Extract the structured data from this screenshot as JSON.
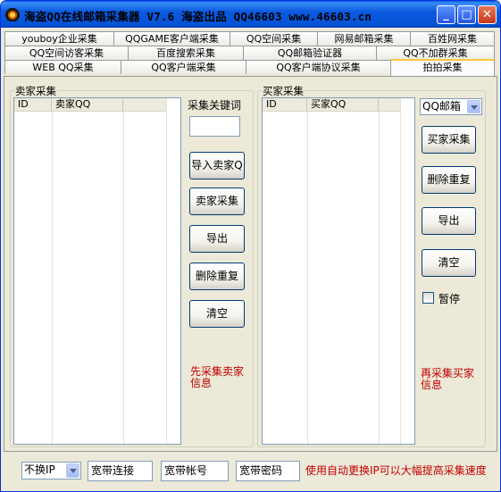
{
  "window": {
    "title": "海盗QQ在线邮箱采集器 V7.6  海盗出品 QQ46603 www.46603.cn",
    "minimize_glyph": "_",
    "maximize_glyph": "□",
    "close_glyph": "✕"
  },
  "tabs": {
    "row1": [
      "youboy企业采集",
      "QQGAME客户端采集",
      "QQ空间采集",
      "网易邮箱采集",
      "百姓网采集"
    ],
    "row2": [
      "QQ空间访客采集",
      "百度搜索采集",
      "QQ邮箱验证器",
      "QQ不加群采集"
    ],
    "row3": [
      "WEB QQ采集",
      "QQ客户端采集",
      "QQ客户端协议采集",
      "拍拍采集"
    ],
    "active": "拍拍采集"
  },
  "seller": {
    "group_label": "卖家采集",
    "columns": [
      "ID",
      "卖家QQ"
    ],
    "keyword_label": "采集关键词",
    "keyword_value": "",
    "buttons": [
      "导入卖家Q",
      "卖家采集",
      "导出",
      "删除重复",
      "清空"
    ],
    "hint": "先采集卖家信息"
  },
  "buyer": {
    "group_label": "买家采集",
    "columns": [
      "ID",
      "买家QQ"
    ],
    "mail_type": "QQ邮箱",
    "buttons": [
      "买家采集",
      "删除重复",
      "导出",
      "清空"
    ],
    "pause_label": "暂停",
    "pause_checked": false,
    "hint": "再采集买家信息"
  },
  "bottom": {
    "ip_mode": "不换IP",
    "connection_field": "宽带连接",
    "account_field": "宽带帐号",
    "password_field": "宽带密码",
    "notice": "使用自动更换IP可以大幅提高采集速度"
  },
  "colors": {
    "title_bar": "#0453d6",
    "hint_red": "#c00000",
    "tab_highlight": "#ffc83c"
  }
}
